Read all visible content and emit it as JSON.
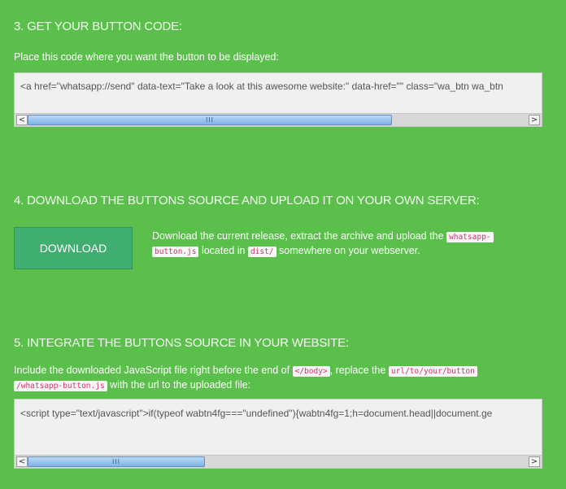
{
  "step3": {
    "heading": "3. GET YOUR BUTTON CODE:",
    "instruction": "Place this code where you want the button to be displayed:",
    "code": "<a href=\"whatsapp://send\" data-text=\"Take a look at this awesome website:\" data-href=\"\" class=\"wa_btn wa_btn"
  },
  "step4": {
    "heading": "4. DOWNLOAD THE BUTTONS SOURCE AND UPLOAD IT ON YOUR OWN SERVER:",
    "button_label": "DOWNLOAD",
    "text_1": "Download the current release, extract the archive and upload the ",
    "code_1a": "whatsapp-",
    "code_1b": "button.js",
    "text_2": " located in ",
    "code_2": "dist/",
    "text_3": " somewhere on your webserver."
  },
  "step5": {
    "heading": "5. INTEGRATE THE BUTTONS SOURCE IN YOUR WEBSITE:",
    "text_1": "Include the downloaded JavaScript file right before the end of ",
    "code_1": "</body>",
    "text_2": ", replace the ",
    "code_2a": "url/to/your/button",
    "code_2b": "/whatsapp-button.js",
    "text_3": " with the url to the uploaded file:",
    "code": "<script type=\"text/javascript\">if(typeof wabtn4fg===\"undefined\"){wabtn4fg=1;h=document.head||document.ge"
  },
  "scrollbar": {
    "left_arrow": "<",
    "right_arrow": ">",
    "grip": "III"
  }
}
